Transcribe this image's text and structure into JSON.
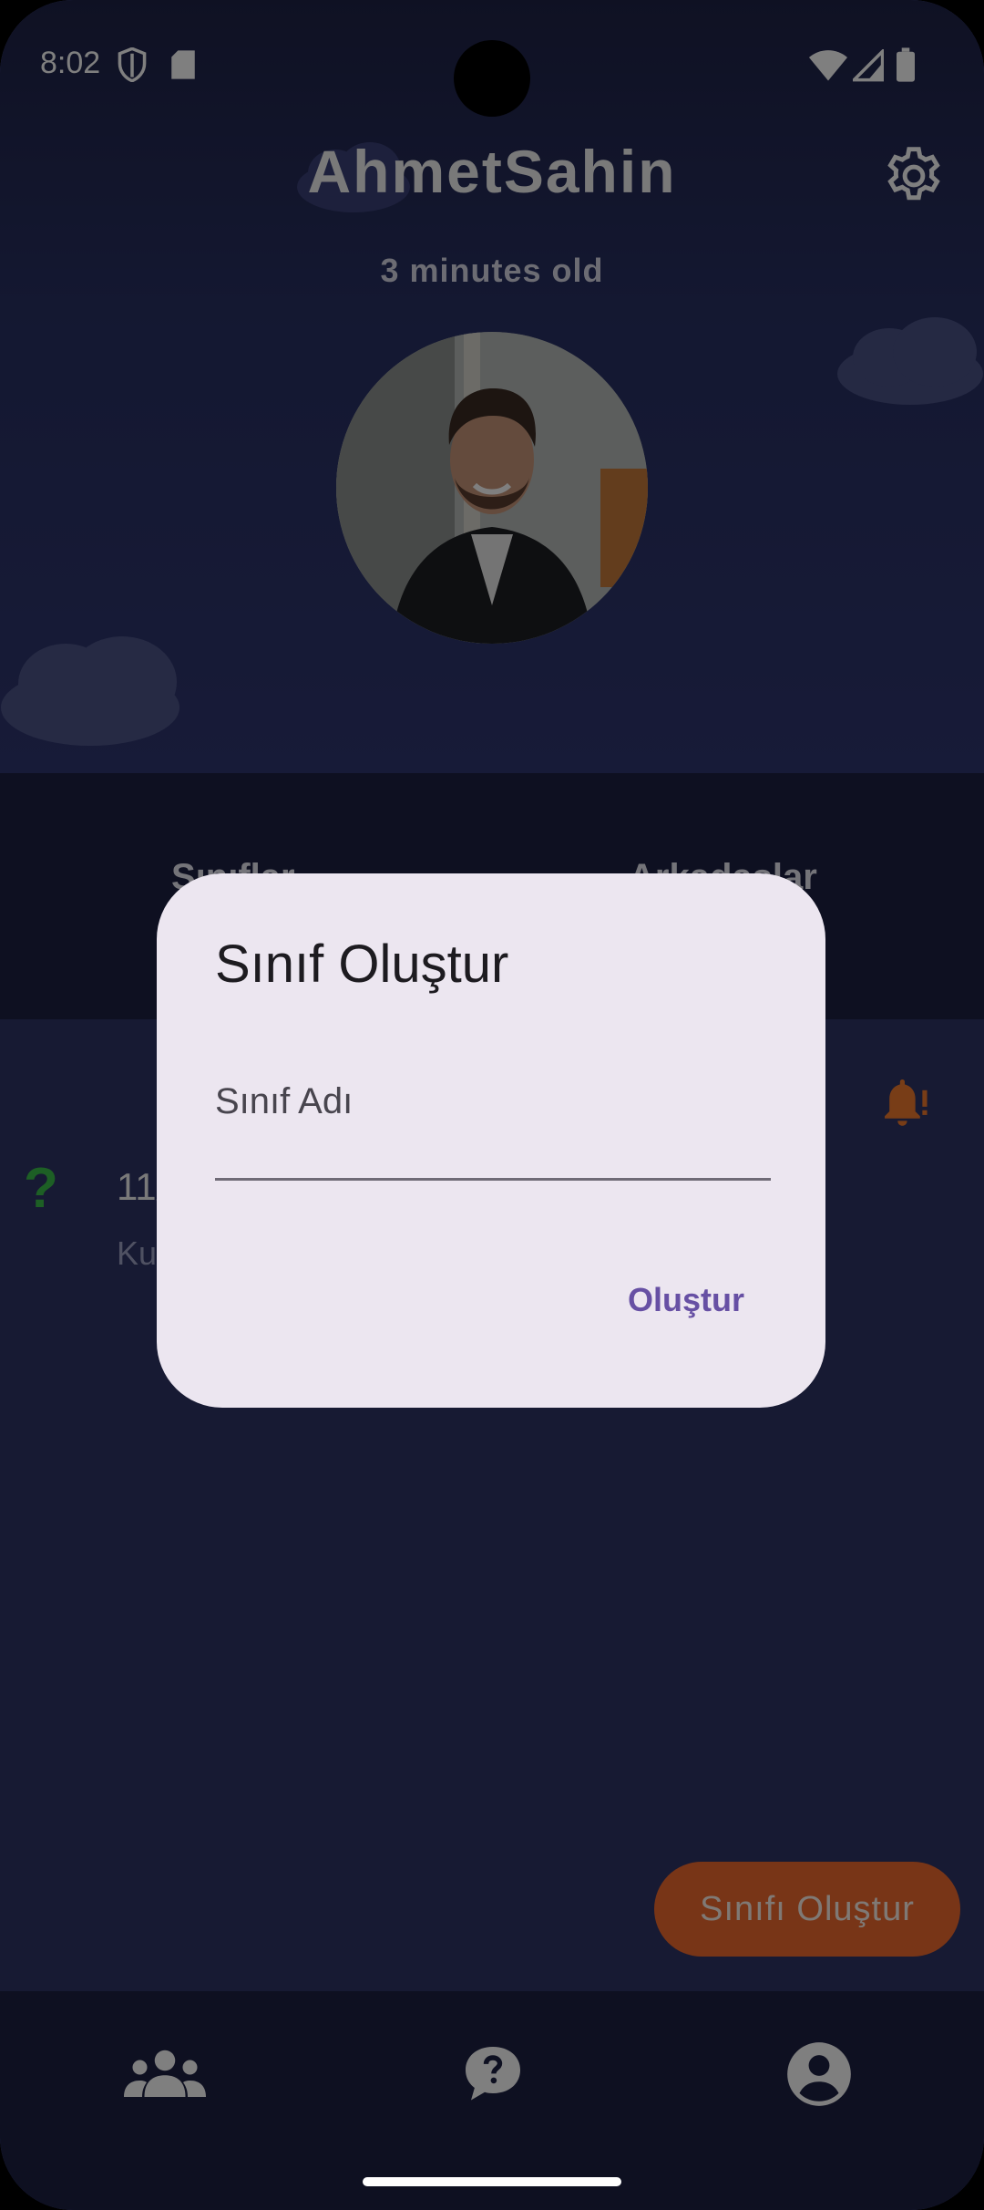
{
  "status_bar": {
    "time": "8:02"
  },
  "header": {
    "username": "AhmetSahin",
    "age": "3 minutes old"
  },
  "tabs": [
    {
      "label": "Sınıflar"
    },
    {
      "label": "Arkadaşlar"
    }
  ],
  "list": {
    "title": "11/",
    "subtitle": "Ku"
  },
  "fab": {
    "label": "Sınıfı Oluştur"
  },
  "dialog": {
    "title": "Sınıf Oluştur",
    "field_placeholder": "Sınıf Adı",
    "confirm_label": "Oluştur"
  },
  "icons": {
    "settings": "gear-icon",
    "bell": "bell-alert-icon",
    "question": "question-mark-icon",
    "nav": [
      "group-icon",
      "question-bubble-icon",
      "account-circle-icon"
    ]
  },
  "colors": {
    "accent": "#f06a2f",
    "dialog_bg": "#ece6f0",
    "dialog_action": "#6750a4",
    "question_green": "#3bbf4a"
  }
}
